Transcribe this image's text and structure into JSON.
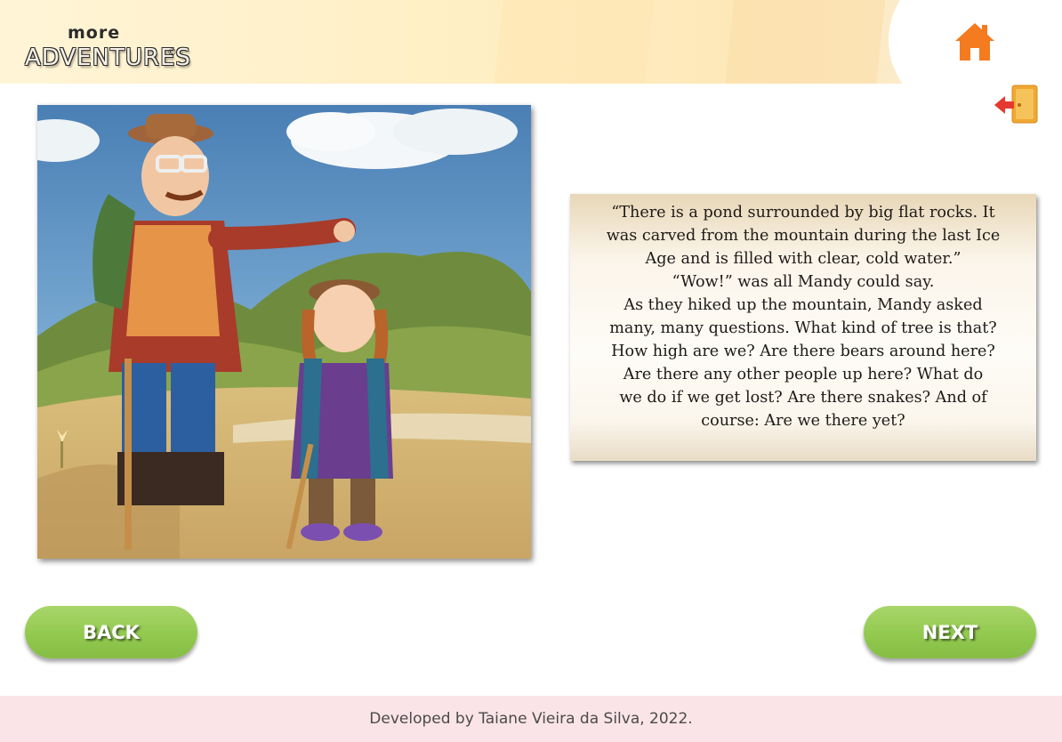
{
  "app": {
    "logo_top": "more",
    "logo_bottom": "ADVENTURES",
    "logo_mark": "©"
  },
  "header": {
    "home_icon": "home-icon",
    "exit_icon": "exit-door-icon",
    "accent": "#f47b20"
  },
  "story": {
    "lines": [
      "“There is a pond surrounded by big flat rocks. It",
      "was carved from the mountain during the last Ice",
      "Age and is filled with clear, cold water.”",
      "“Wow!” was all Mandy could say.",
      "As they hiked up the mountain, Mandy asked",
      "many, many questions. What kind of tree is that?",
      "How high are we? Are there bears around here?",
      "Are there any other people up here? What do",
      "we do if we get lost? Are there snakes? And of",
      "course: Are we there yet?"
    ]
  },
  "navigation": {
    "back_label": "BACK",
    "next_label": "NEXT",
    "button_color": "#92c94f"
  },
  "footer": {
    "credit": "Developed by Taiane Vieira da Silva, 2022."
  }
}
